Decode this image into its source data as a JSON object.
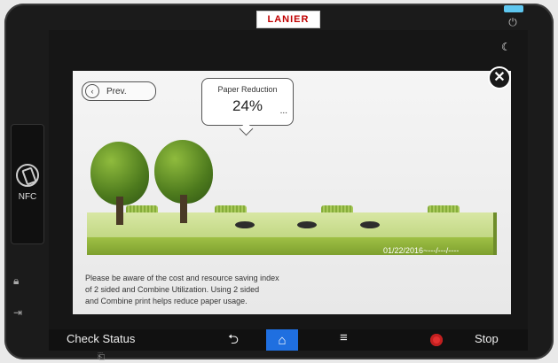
{
  "device": {
    "brand": "LANIER",
    "nfc_label": "NFC",
    "icons": {
      "power": "power-icon",
      "moon": "moon-icon",
      "left_top": "lock-icon",
      "left_bottom": "login-icon",
      "footer": "usb-icon"
    }
  },
  "dialog": {
    "prev_label": "Prev.",
    "bubble_title": "Paper Reduction",
    "bubble_value": "24%",
    "bubble_more": "...",
    "date_range": "01/22/2016~---/---/----",
    "message_lines": [
      "Please be aware of the cost and resource saving index",
      "of 2 sided and Combine Utilization. Using 2 sided",
      "and Combine print helps reduce paper usage."
    ],
    "close_icon": "close-icon"
  },
  "taskbar": {
    "check_status": "Check Status",
    "back_icon": "back-icon",
    "home_icon": "home-icon",
    "menu_icon": "menu-icon",
    "stop_label": "Stop",
    "accent_color": "#1f6fe0",
    "stop_color": "#e23030"
  }
}
